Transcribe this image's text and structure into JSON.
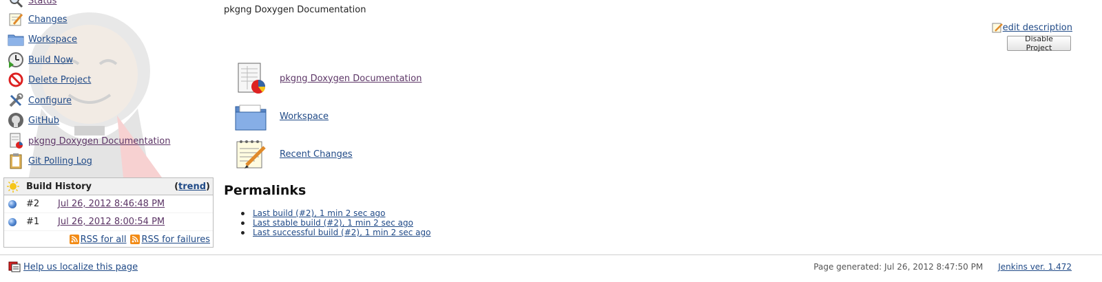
{
  "sidebar": {
    "items": [
      {
        "label": "Status",
        "icon": "search-icon"
      },
      {
        "label": "Changes",
        "icon": "notepad-icon"
      },
      {
        "label": "Workspace",
        "icon": "folder-icon"
      },
      {
        "label": "Build Now",
        "icon": "clock-play-icon"
      },
      {
        "label": "Delete Project",
        "icon": "no-entry-icon"
      },
      {
        "label": "Configure",
        "icon": "tools-icon"
      },
      {
        "label": "GitHub",
        "icon": "github-icon"
      },
      {
        "label": "pkgng Doxygen Documentation",
        "icon": "report-icon"
      },
      {
        "label": "Git Polling Log",
        "icon": "clipboard-icon"
      }
    ]
  },
  "build_history": {
    "title": "Build History",
    "trend_open": "(",
    "trend_label": "trend",
    "trend_close": ")",
    "builds": [
      {
        "number": "#2",
        "date": "Jul 26, 2012 8:46:48 PM",
        "status_color": "#3465a4"
      },
      {
        "number": "#1",
        "date": "Jul 26, 2012 8:00:54 PM",
        "status_color": "#3465a4"
      }
    ],
    "rss_all": "RSS for all",
    "rss_failures": "RSS for failures"
  },
  "main": {
    "description": "pkgng Doxygen Documentation",
    "edit_description": "edit description",
    "disable_button": "Disable Project",
    "big_links": [
      {
        "label": "pkgng Doxygen Documentation",
        "icon": "report-icon"
      },
      {
        "label": "Workspace",
        "icon": "folder-icon"
      },
      {
        "label": "Recent Changes",
        "icon": "notepad-icon"
      }
    ],
    "permalinks_title": "Permalinks",
    "permalinks": [
      "Last build (#2), 1 min 2 sec ago",
      "Last stable build (#2), 1 min 2 sec ago",
      "Last successful build (#2), 1 min 2 sec ago"
    ]
  },
  "footer": {
    "localize": "Help us localize this page",
    "generated": "Page generated: Jul 26, 2012 8:47:50 PM",
    "version": "Jenkins ver. 1.472"
  },
  "colors": {
    "link": "#204a87",
    "visited_link": "#5c3566",
    "rss": "#f28b16",
    "stable_ball": "#3465a4"
  }
}
